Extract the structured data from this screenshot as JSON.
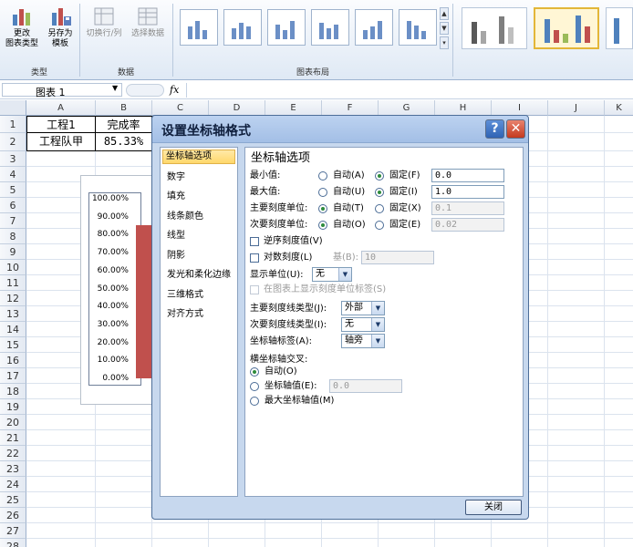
{
  "ribbon": {
    "type_group": {
      "change_type": "更改\n图表类型",
      "change_type_l1": "更改",
      "change_type_l2": "图表类型",
      "save_template_l1": "另存为",
      "save_template_l2": "模板",
      "label": "类型"
    },
    "data_group": {
      "switch_row_col": "切换行/列",
      "select_data": "选择数据",
      "label": "数据"
    },
    "layout_group": {
      "label": "图表布局"
    }
  },
  "formula_bar": {
    "name_box": "图表 1",
    "fx": "fx"
  },
  "sheet": {
    "columns": [
      "A",
      "B",
      "C",
      "D",
      "E",
      "F",
      "G",
      "H",
      "I",
      "J",
      "K"
    ],
    "rows": [
      "1",
      "2",
      "3",
      "4",
      "5",
      "6",
      "7",
      "8",
      "9",
      "10",
      "11",
      "12",
      "13",
      "14",
      "15",
      "16",
      "17",
      "18",
      "19",
      "20",
      "21",
      "22",
      "23",
      "24",
      "25",
      "26",
      "27",
      "28"
    ],
    "cells": {
      "a1": "工程1",
      "b1": "完成率",
      "a2": "工程队甲",
      "b2": "85.33%"
    }
  },
  "chart": {
    "y_ticks": [
      "100.00%",
      "90.00%",
      "80.00%",
      "70.00%",
      "60.00%",
      "50.00%",
      "40.00%",
      "30.00%",
      "20.00%",
      "10.00%",
      "0.00%"
    ],
    "bar_value": 0.8533,
    "bar_color": "#c0504d"
  },
  "dialog": {
    "title": "设置坐标轴格式",
    "help": "?",
    "close_x": "X",
    "nav": [
      "坐标轴选项",
      "数字",
      "填充",
      "线条颜色",
      "线型",
      "阴影",
      "发光和柔化边缘",
      "三维格式",
      "对齐方式"
    ],
    "section_title": "坐标轴选项",
    "min": {
      "label": "最小值:",
      "auto": "自动(A)",
      "fixed": "固定(F)",
      "value": "0.0"
    },
    "max": {
      "label": "最大值:",
      "auto": "自动(U)",
      "fixed": "固定(I)",
      "value": "1.0"
    },
    "major": {
      "label": "主要刻度单位:",
      "auto": "自动(T)",
      "fixed": "固定(X)",
      "value": "0.1"
    },
    "minor": {
      "label": "次要刻度单位:",
      "auto": "自动(O)",
      "fixed": "固定(E)",
      "value": "0.02"
    },
    "reverse": "逆序刻度值(V)",
    "log": {
      "label": "对数刻度(L)",
      "base_label": "基(B):",
      "base_value": "10"
    },
    "display_units": {
      "label": "显示单位(U):",
      "value": "无"
    },
    "show_units_label": "在图表上显示刻度单位标签(S)",
    "major_tick": {
      "label": "主要刻度线类型(J):",
      "value": "外部"
    },
    "minor_tick": {
      "label": "次要刻度线类型(I):",
      "value": "无"
    },
    "axis_labels": {
      "label": "坐标轴标签(A):",
      "value": "轴旁"
    },
    "cross": {
      "title": "横坐标轴交叉:",
      "auto": "自动(O)",
      "axis_value": "坐标轴值(E):",
      "axis_value_input": "0.0",
      "max": "最大坐标轴值(M)"
    },
    "close_button": "关闭"
  }
}
